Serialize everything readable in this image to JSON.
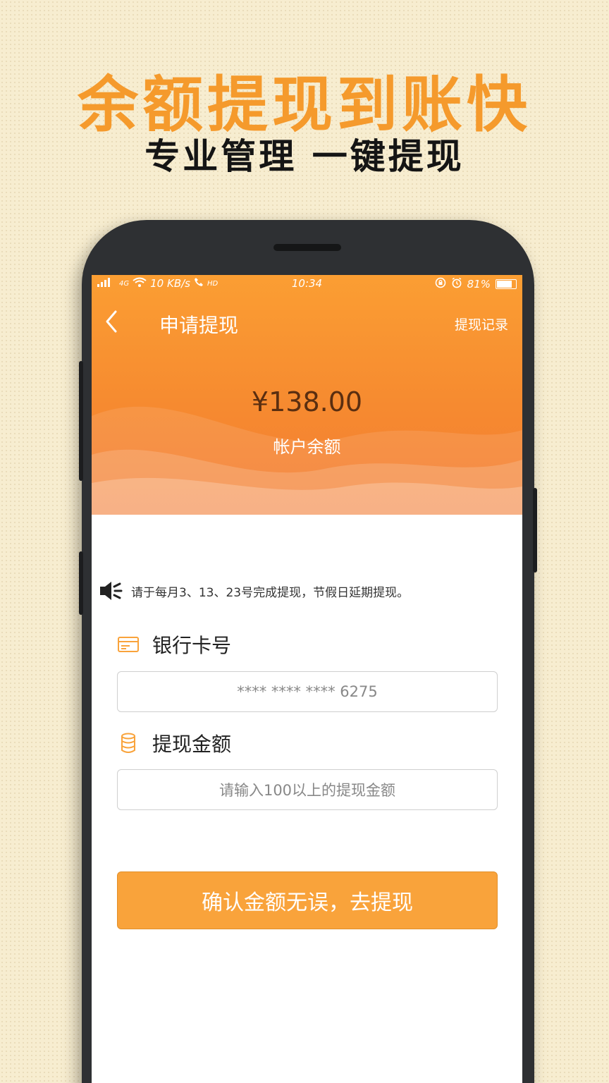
{
  "banner": {
    "headline": "余额提现到账快",
    "subline": "专业管理 一键提现"
  },
  "status_bar": {
    "signal": "4G",
    "speed": "10 KB/s",
    "hd": "HD",
    "time": "10:34",
    "battery": "81%"
  },
  "nav": {
    "title": "申请提现",
    "action": "提现记录"
  },
  "balance": {
    "amount": "¥138.00",
    "label": "帐户余额"
  },
  "notice": {
    "text": "请于每月3、13、23号完成提现，节假日延期提现。"
  },
  "form": {
    "card_label": "银行卡号",
    "card_value": "**** **** **** 6275",
    "amount_label": "提现金额",
    "amount_placeholder": "请输入100以上的提现金额",
    "submit_label": "确认金额无误，去提现"
  },
  "colors": {
    "accent": "#f9a33b",
    "header_top": "#fb9e33",
    "header_bottom": "#f37c33",
    "background": "#f7edd0"
  }
}
